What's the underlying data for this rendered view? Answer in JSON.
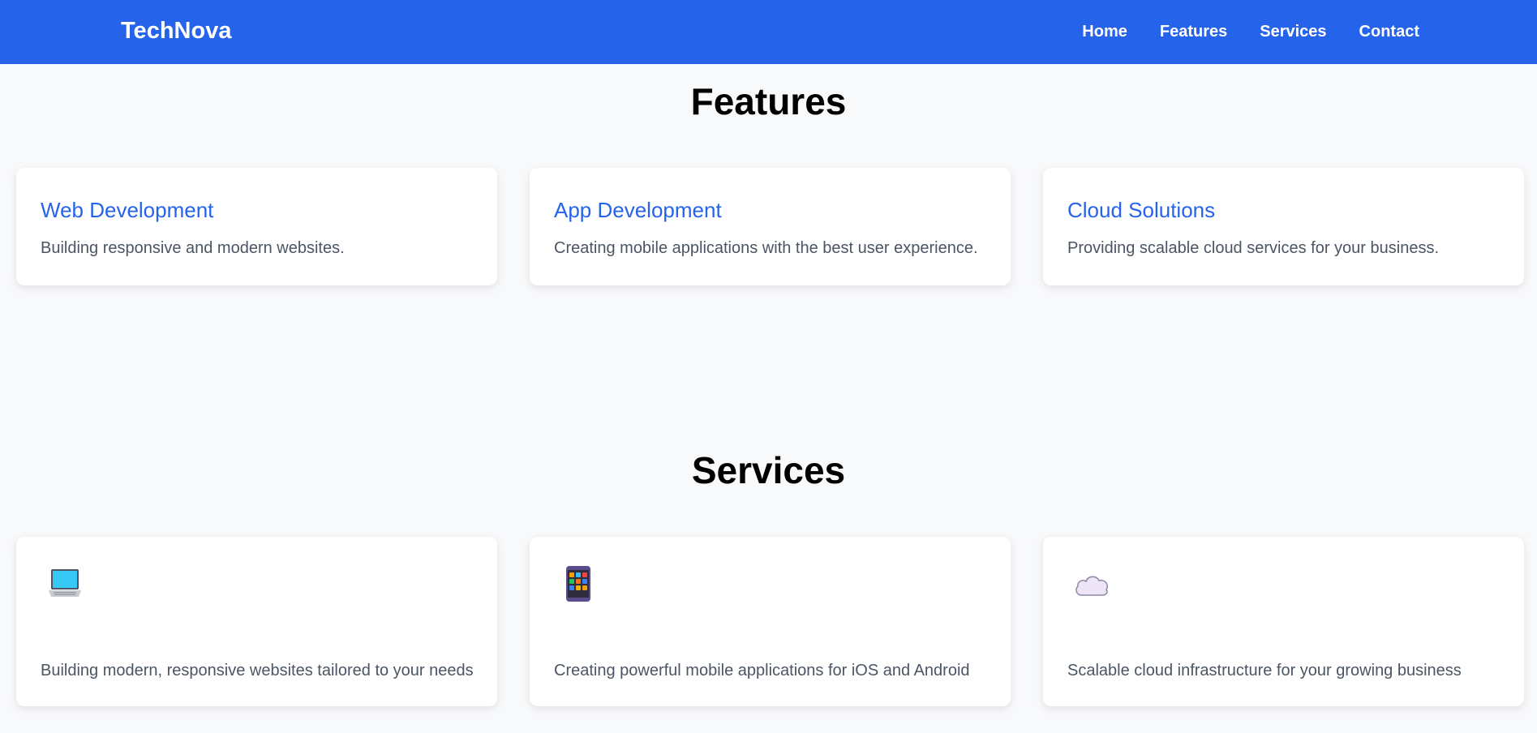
{
  "header": {
    "brand": "TechNova",
    "nav": [
      "Home",
      "Features",
      "Services",
      "Contact"
    ]
  },
  "features": {
    "title": "Features",
    "cards": [
      {
        "title": "Web Development",
        "description": "Building responsive and modern websites."
      },
      {
        "title": "App Development",
        "description": "Creating mobile applications with the best user experience."
      },
      {
        "title": "Cloud Solutions",
        "description": "Providing scalable cloud services for your business."
      }
    ]
  },
  "services": {
    "title": "Services",
    "cards": [
      {
        "icon": "laptop-icon",
        "description": "Building modern, responsive websites tailored to your needs"
      },
      {
        "icon": "mobile-icon",
        "description": "Creating powerful mobile applications for iOS and Android"
      },
      {
        "icon": "cloud-icon",
        "description": "Scalable cloud infrastructure for your growing business"
      }
    ]
  },
  "colors": {
    "primary": "#2563eb",
    "background": "#f8f9fb",
    "text_muted": "#4b5563"
  }
}
